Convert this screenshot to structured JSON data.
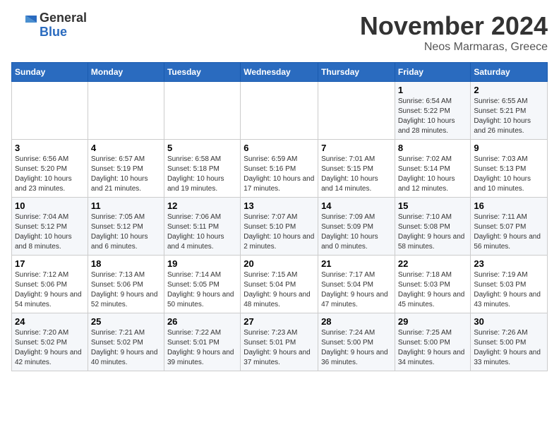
{
  "header": {
    "logo_general": "General",
    "logo_blue": "Blue",
    "month_title": "November 2024",
    "location": "Neos Marmaras, Greece"
  },
  "days_of_week": [
    "Sunday",
    "Monday",
    "Tuesday",
    "Wednesday",
    "Thursday",
    "Friday",
    "Saturday"
  ],
  "weeks": [
    [
      {
        "day": "",
        "info": ""
      },
      {
        "day": "",
        "info": ""
      },
      {
        "day": "",
        "info": ""
      },
      {
        "day": "",
        "info": ""
      },
      {
        "day": "",
        "info": ""
      },
      {
        "day": "1",
        "info": "Sunrise: 6:54 AM\nSunset: 5:22 PM\nDaylight: 10 hours and 28 minutes."
      },
      {
        "day": "2",
        "info": "Sunrise: 6:55 AM\nSunset: 5:21 PM\nDaylight: 10 hours and 26 minutes."
      }
    ],
    [
      {
        "day": "3",
        "info": "Sunrise: 6:56 AM\nSunset: 5:20 PM\nDaylight: 10 hours and 23 minutes."
      },
      {
        "day": "4",
        "info": "Sunrise: 6:57 AM\nSunset: 5:19 PM\nDaylight: 10 hours and 21 minutes."
      },
      {
        "day": "5",
        "info": "Sunrise: 6:58 AM\nSunset: 5:18 PM\nDaylight: 10 hours and 19 minutes."
      },
      {
        "day": "6",
        "info": "Sunrise: 6:59 AM\nSunset: 5:16 PM\nDaylight: 10 hours and 17 minutes."
      },
      {
        "day": "7",
        "info": "Sunrise: 7:01 AM\nSunset: 5:15 PM\nDaylight: 10 hours and 14 minutes."
      },
      {
        "day": "8",
        "info": "Sunrise: 7:02 AM\nSunset: 5:14 PM\nDaylight: 10 hours and 12 minutes."
      },
      {
        "day": "9",
        "info": "Sunrise: 7:03 AM\nSunset: 5:13 PM\nDaylight: 10 hours and 10 minutes."
      }
    ],
    [
      {
        "day": "10",
        "info": "Sunrise: 7:04 AM\nSunset: 5:12 PM\nDaylight: 10 hours and 8 minutes."
      },
      {
        "day": "11",
        "info": "Sunrise: 7:05 AM\nSunset: 5:12 PM\nDaylight: 10 hours and 6 minutes."
      },
      {
        "day": "12",
        "info": "Sunrise: 7:06 AM\nSunset: 5:11 PM\nDaylight: 10 hours and 4 minutes."
      },
      {
        "day": "13",
        "info": "Sunrise: 7:07 AM\nSunset: 5:10 PM\nDaylight: 10 hours and 2 minutes."
      },
      {
        "day": "14",
        "info": "Sunrise: 7:09 AM\nSunset: 5:09 PM\nDaylight: 10 hours and 0 minutes."
      },
      {
        "day": "15",
        "info": "Sunrise: 7:10 AM\nSunset: 5:08 PM\nDaylight: 9 hours and 58 minutes."
      },
      {
        "day": "16",
        "info": "Sunrise: 7:11 AM\nSunset: 5:07 PM\nDaylight: 9 hours and 56 minutes."
      }
    ],
    [
      {
        "day": "17",
        "info": "Sunrise: 7:12 AM\nSunset: 5:06 PM\nDaylight: 9 hours and 54 minutes."
      },
      {
        "day": "18",
        "info": "Sunrise: 7:13 AM\nSunset: 5:06 PM\nDaylight: 9 hours and 52 minutes."
      },
      {
        "day": "19",
        "info": "Sunrise: 7:14 AM\nSunset: 5:05 PM\nDaylight: 9 hours and 50 minutes."
      },
      {
        "day": "20",
        "info": "Sunrise: 7:15 AM\nSunset: 5:04 PM\nDaylight: 9 hours and 48 minutes."
      },
      {
        "day": "21",
        "info": "Sunrise: 7:17 AM\nSunset: 5:04 PM\nDaylight: 9 hours and 47 minutes."
      },
      {
        "day": "22",
        "info": "Sunrise: 7:18 AM\nSunset: 5:03 PM\nDaylight: 9 hours and 45 minutes."
      },
      {
        "day": "23",
        "info": "Sunrise: 7:19 AM\nSunset: 5:03 PM\nDaylight: 9 hours and 43 minutes."
      }
    ],
    [
      {
        "day": "24",
        "info": "Sunrise: 7:20 AM\nSunset: 5:02 PM\nDaylight: 9 hours and 42 minutes."
      },
      {
        "day": "25",
        "info": "Sunrise: 7:21 AM\nSunset: 5:02 PM\nDaylight: 9 hours and 40 minutes."
      },
      {
        "day": "26",
        "info": "Sunrise: 7:22 AM\nSunset: 5:01 PM\nDaylight: 9 hours and 39 minutes."
      },
      {
        "day": "27",
        "info": "Sunrise: 7:23 AM\nSunset: 5:01 PM\nDaylight: 9 hours and 37 minutes."
      },
      {
        "day": "28",
        "info": "Sunrise: 7:24 AM\nSunset: 5:00 PM\nDaylight: 9 hours and 36 minutes."
      },
      {
        "day": "29",
        "info": "Sunrise: 7:25 AM\nSunset: 5:00 PM\nDaylight: 9 hours and 34 minutes."
      },
      {
        "day": "30",
        "info": "Sunrise: 7:26 AM\nSunset: 5:00 PM\nDaylight: 9 hours and 33 minutes."
      }
    ]
  ]
}
